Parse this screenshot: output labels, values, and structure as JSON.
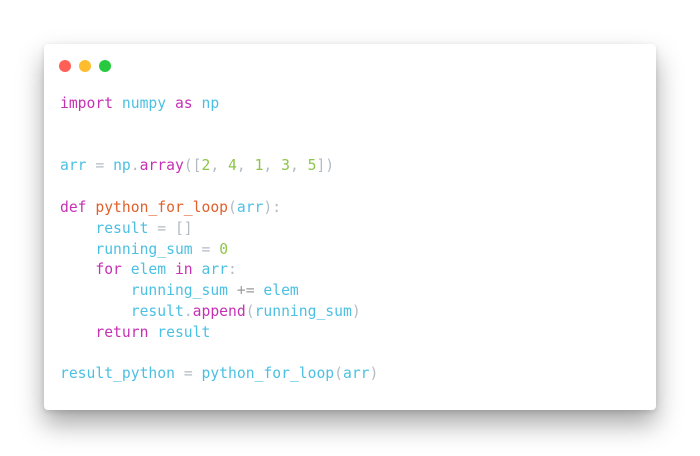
{
  "window": {
    "traffic_lights": [
      {
        "name": "close",
        "color": "#ff5f56"
      },
      {
        "name": "minimize",
        "color": "#ffbd2e"
      },
      {
        "name": "maximize",
        "color": "#27c93f"
      }
    ]
  },
  "syntax_colors": {
    "keyword": "#c631b4",
    "identifier": "#4cc0e3",
    "function_def": "#e2602b",
    "number": "#8dc548",
    "punctuation": "#b3bbc4"
  },
  "code": {
    "lines": [
      [
        {
          "t": "import",
          "c": "kw"
        },
        {
          "t": " "
        },
        {
          "t": "numpy",
          "c": "id"
        },
        {
          "t": " "
        },
        {
          "t": "as",
          "c": "kw"
        },
        {
          "t": " "
        },
        {
          "t": "np",
          "c": "id"
        }
      ],
      [],
      [],
      [
        {
          "t": "arr",
          "c": "id"
        },
        {
          "t": " "
        },
        {
          "t": "=",
          "c": "pun"
        },
        {
          "t": " "
        },
        {
          "t": "np",
          "c": "id"
        },
        {
          "t": ".",
          "c": "pun"
        },
        {
          "t": "array",
          "c": "kw"
        },
        {
          "t": "([",
          "c": "pun"
        },
        {
          "t": "2",
          "c": "num"
        },
        {
          "t": ", ",
          "c": "pun"
        },
        {
          "t": "4",
          "c": "num"
        },
        {
          "t": ", ",
          "c": "pun"
        },
        {
          "t": "1",
          "c": "num"
        },
        {
          "t": ", ",
          "c": "pun"
        },
        {
          "t": "3",
          "c": "num"
        },
        {
          "t": ", ",
          "c": "pun"
        },
        {
          "t": "5",
          "c": "num"
        },
        {
          "t": "])",
          "c": "pun"
        }
      ],
      [],
      [
        {
          "t": "def",
          "c": "kw"
        },
        {
          "t": " "
        },
        {
          "t": "python_for_loop",
          "c": "fn"
        },
        {
          "t": "(",
          "c": "pun"
        },
        {
          "t": "arr",
          "c": "id"
        },
        {
          "t": "):",
          "c": "pun"
        }
      ],
      [
        {
          "t": "    "
        },
        {
          "t": "result",
          "c": "id"
        },
        {
          "t": " "
        },
        {
          "t": "=",
          "c": "pun"
        },
        {
          "t": " "
        },
        {
          "t": "[]",
          "c": "pun"
        }
      ],
      [
        {
          "t": "    "
        },
        {
          "t": "running_sum",
          "c": "id"
        },
        {
          "t": " "
        },
        {
          "t": "=",
          "c": "pun"
        },
        {
          "t": " "
        },
        {
          "t": "0",
          "c": "num"
        }
      ],
      [
        {
          "t": "    "
        },
        {
          "t": "for",
          "c": "kw"
        },
        {
          "t": " "
        },
        {
          "t": "elem",
          "c": "id"
        },
        {
          "t": " "
        },
        {
          "t": "in",
          "c": "kw"
        },
        {
          "t": " "
        },
        {
          "t": "arr",
          "c": "id"
        },
        {
          "t": ":",
          "c": "pun"
        }
      ],
      [
        {
          "t": "        "
        },
        {
          "t": "running_sum",
          "c": "id"
        },
        {
          "t": " "
        },
        {
          "t": "+=",
          "c": "op"
        },
        {
          "t": " "
        },
        {
          "t": "elem",
          "c": "id"
        }
      ],
      [
        {
          "t": "        "
        },
        {
          "t": "result",
          "c": "id"
        },
        {
          "t": ".",
          "c": "pun"
        },
        {
          "t": "append",
          "c": "kw"
        },
        {
          "t": "(",
          "c": "pun"
        },
        {
          "t": "running_sum",
          "c": "id"
        },
        {
          "t": ")",
          "c": "pun"
        }
      ],
      [
        {
          "t": "    "
        },
        {
          "t": "return",
          "c": "kw"
        },
        {
          "t": " "
        },
        {
          "t": "result",
          "c": "id"
        }
      ],
      [],
      [
        {
          "t": "result_python",
          "c": "id"
        },
        {
          "t": " "
        },
        {
          "t": "=",
          "c": "pun"
        },
        {
          "t": " "
        },
        {
          "t": "python_for_loop",
          "c": "id"
        },
        {
          "t": "(",
          "c": "pun"
        },
        {
          "t": "arr",
          "c": "id"
        },
        {
          "t": ")",
          "c": "pun"
        }
      ]
    ]
  }
}
